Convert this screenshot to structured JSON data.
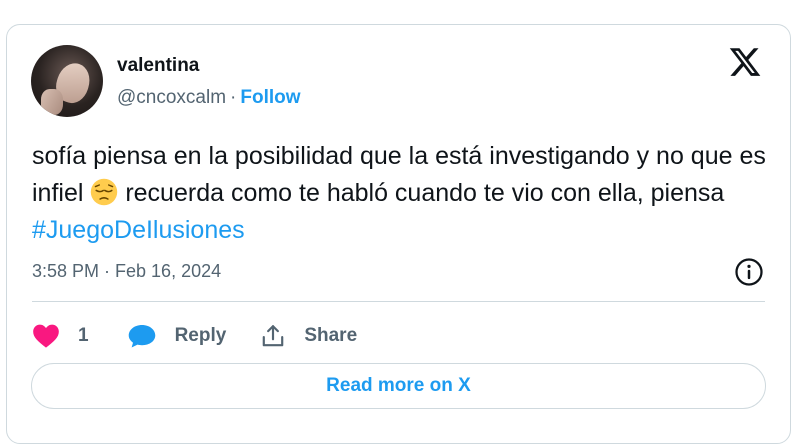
{
  "user": {
    "name": "valentina",
    "handle": "@cncoxcalm",
    "separator": "·",
    "follow_label": "Follow"
  },
  "tweet": {
    "text_part1": "sofía piensa en la posibilidad que la está investigando y no que es infiel",
    "emoji": "😔",
    "text_part2": "recuerda como te habló cuando te vio con ella, piensa",
    "hashtag": "#JuegoDeIlusiones",
    "timestamp": "3:58 PM · Feb 16, 2024"
  },
  "actions": {
    "like_count": "1",
    "reply_label": "Reply",
    "share_label": "Share"
  },
  "footer": {
    "read_more_label": "Read more on X"
  },
  "colors": {
    "accent": "#1d9bf0",
    "like": "#f91880",
    "secondary_text": "#536471",
    "border": "#cfd9de"
  },
  "icons": [
    "x-logo-icon",
    "info-icon",
    "heart-icon",
    "reply-bubble-icon",
    "share-icon",
    "pensive-emoji"
  ]
}
